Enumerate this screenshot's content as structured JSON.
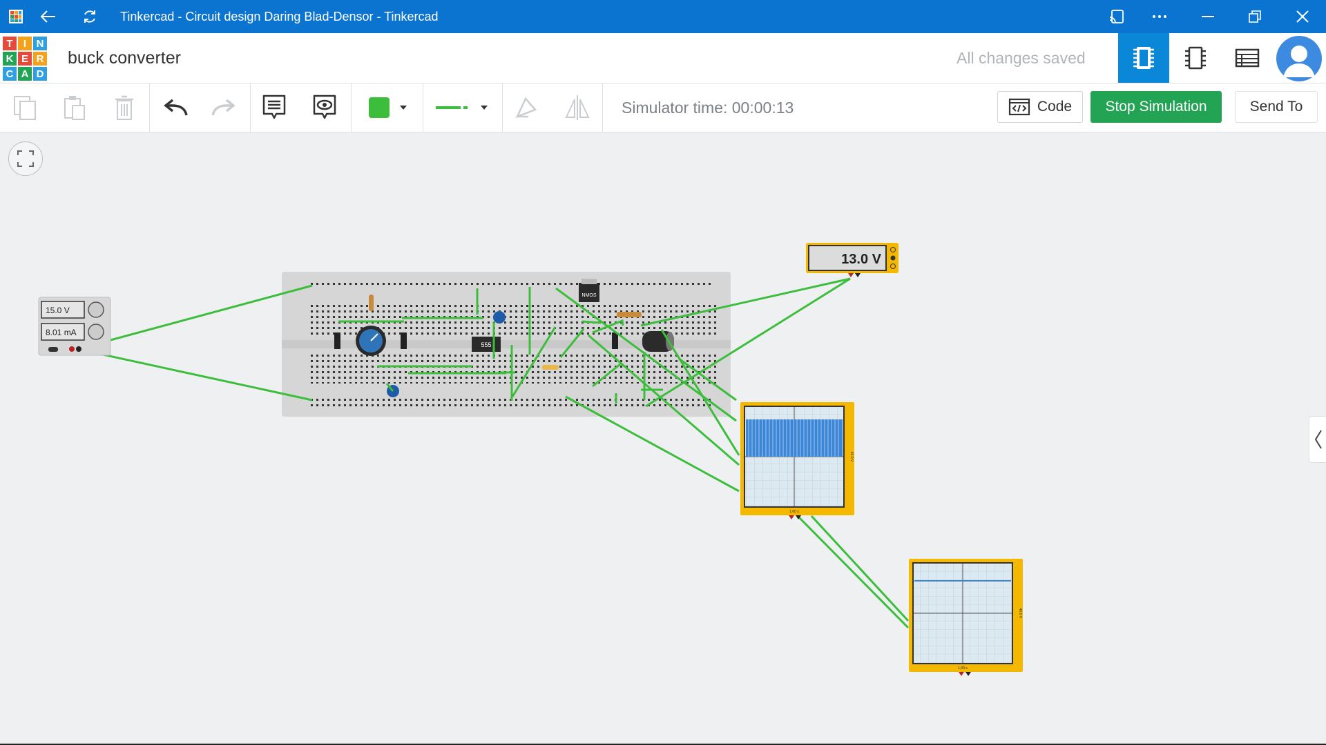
{
  "window": {
    "title": "Tinkercad - Circuit design Daring Blad-Densor - Tinkercad"
  },
  "app": {
    "logo_letters": [
      "T",
      "I",
      "N",
      "K",
      "E",
      "R",
      "C",
      "A",
      "D"
    ],
    "logo_colors": [
      "#e64a3b",
      "#f4a21b",
      "#2f9fe0",
      "#23a455",
      "#e64a3b",
      "#f4a21b",
      "#2f9fe0",
      "#23a455",
      "#2f9fe0"
    ]
  },
  "project": {
    "name": "buck converter",
    "save_status": "All changes saved"
  },
  "toolbar": {
    "simulator_time": "Simulator time: 00:00:13",
    "code_label": "Code",
    "stop_label": "Stop Simulation",
    "send_label": "Send To",
    "color_swatch": "#3cbe3c",
    "wire_color": "#3cbe3c"
  },
  "circuit": {
    "power_supply": {
      "voltage": "15.0 V",
      "current": "8.01 mA"
    },
    "multimeter": {
      "reading": "13.0 V"
    },
    "chip_label": "555",
    "mosfet_label": "NMOS",
    "oscilloscope_1": {
      "time_label": "1.00 s",
      "volt_label": "40.0 V"
    },
    "oscilloscope_2": {
      "time_label": "1.00 s",
      "volt_label": "40.0 V"
    }
  },
  "colors": {
    "accent": "#0b74d1",
    "active_view": "#0b87d8",
    "stop_button": "#23a455",
    "wire": "#3cbe3c",
    "instrument": "#f5b800"
  }
}
